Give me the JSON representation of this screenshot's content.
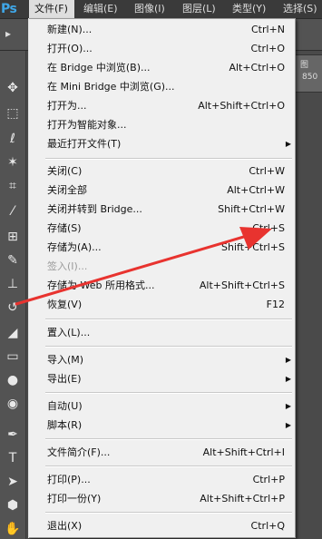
{
  "app": {
    "logo": "Ps"
  },
  "menubar": [
    {
      "label": "文件(F)",
      "active": true
    },
    {
      "label": "编辑(E)",
      "active": false
    },
    {
      "label": "图像(I)",
      "active": false
    },
    {
      "label": "图层(L)",
      "active": false
    },
    {
      "label": "类型(Y)",
      "active": false
    },
    {
      "label": "选择(S)",
      "active": false
    }
  ],
  "right_panel": {
    "label": "图",
    "value": "850"
  },
  "file_menu": {
    "items": [
      {
        "label": "新建(N)...",
        "shortcut": "Ctrl+N"
      },
      {
        "label": "打开(O)...",
        "shortcut": "Ctrl+O"
      },
      {
        "label": "在 Bridge 中浏览(B)...",
        "shortcut": "Alt+Ctrl+O"
      },
      {
        "label": "在 Mini Bridge 中浏览(G)...",
        "shortcut": ""
      },
      {
        "label": "打开为...",
        "shortcut": "Alt+Shift+Ctrl+O"
      },
      {
        "label": "打开为智能对象...",
        "shortcut": ""
      },
      {
        "label": "最近打开文件(T)",
        "shortcut": "",
        "submenu": true
      },
      {
        "label": "关闭(C)",
        "shortcut": "Ctrl+W"
      },
      {
        "label": "关闭全部",
        "shortcut": "Alt+Ctrl+W"
      },
      {
        "label": "关闭并转到 Bridge...",
        "shortcut": "Shift+Ctrl+W"
      },
      {
        "label": "存储(S)",
        "shortcut": "Ctrl+S"
      },
      {
        "label": "存储为(A)...",
        "shortcut": "Shift+Ctrl+S"
      },
      {
        "label": "签入(I)...",
        "shortcut": "",
        "disabled": true
      },
      {
        "label": "存储为 Web 所用格式...",
        "shortcut": "Alt+Shift+Ctrl+S"
      },
      {
        "label": "恢复(V)",
        "shortcut": "F12"
      },
      {
        "label": "置入(L)...",
        "shortcut": ""
      },
      {
        "label": "导入(M)",
        "shortcut": "",
        "submenu": true
      },
      {
        "label": "导出(E)",
        "shortcut": "",
        "submenu": true
      },
      {
        "label": "自动(U)",
        "shortcut": "",
        "submenu": true
      },
      {
        "label": "脚本(R)",
        "shortcut": "",
        "submenu": true
      },
      {
        "label": "文件简介(F)...",
        "shortcut": "Alt+Shift+Ctrl+I"
      },
      {
        "label": "打印(P)...",
        "shortcut": "Ctrl+P"
      },
      {
        "label": "打印一份(Y)",
        "shortcut": "Alt+Shift+Ctrl+P"
      },
      {
        "label": "退出(X)",
        "shortcut": "Ctrl+Q"
      }
    ]
  },
  "tools": [
    "move-tool-icon",
    "marquee-tool-icon",
    "lasso-tool-icon",
    "magic-wand-icon",
    "crop-tool-icon",
    "eyedropper-icon",
    "healing-brush-icon",
    "brush-tool-icon",
    "clone-stamp-icon",
    "history-brush-icon",
    "eraser-tool-icon",
    "gradient-tool-icon",
    "blur-tool-icon",
    "dodge-tool-icon",
    "pen-tool-icon",
    "type-tool-icon",
    "path-selection-icon",
    "shape-tool-icon",
    "hand-tool-icon"
  ],
  "colors": {
    "menu_bg": "#f0f0f0",
    "annotation_arrow": "#e8332f",
    "ps_blue": "#3fa7e8"
  }
}
